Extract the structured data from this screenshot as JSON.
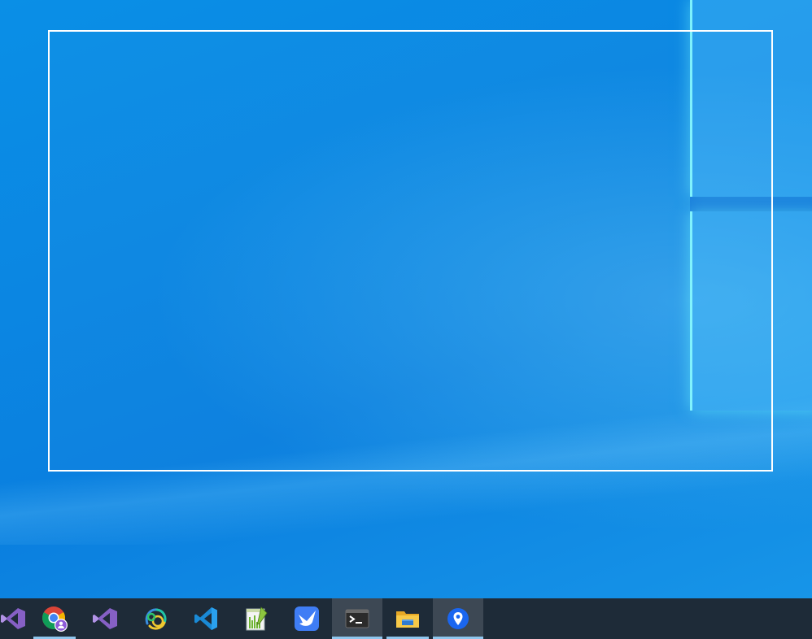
{
  "desktop": {
    "background_color": "#0a86e2",
    "selection_border_color": "#ffffff"
  },
  "taskbar": {
    "background_color": "#1e2b38",
    "indicator_color": "#8fc6ee",
    "items": [
      {
        "icon": "visual-studio-icon",
        "state": "idle"
      },
      {
        "icon": "chrome-profile-icon",
        "state": "running"
      },
      {
        "icon": "visual-studio-icon",
        "state": "idle"
      },
      {
        "icon": "datagrip-icon",
        "state": "idle"
      },
      {
        "icon": "vscode-icon",
        "state": "idle"
      },
      {
        "icon": "notepad-plus-plus-icon",
        "state": "idle"
      },
      {
        "icon": "feishu-lark-icon",
        "state": "idle"
      },
      {
        "icon": "terminal-icon",
        "state": "active"
      },
      {
        "icon": "file-explorer-icon",
        "state": "running"
      },
      {
        "icon": "location-pin-app-icon",
        "state": "active"
      }
    ]
  }
}
